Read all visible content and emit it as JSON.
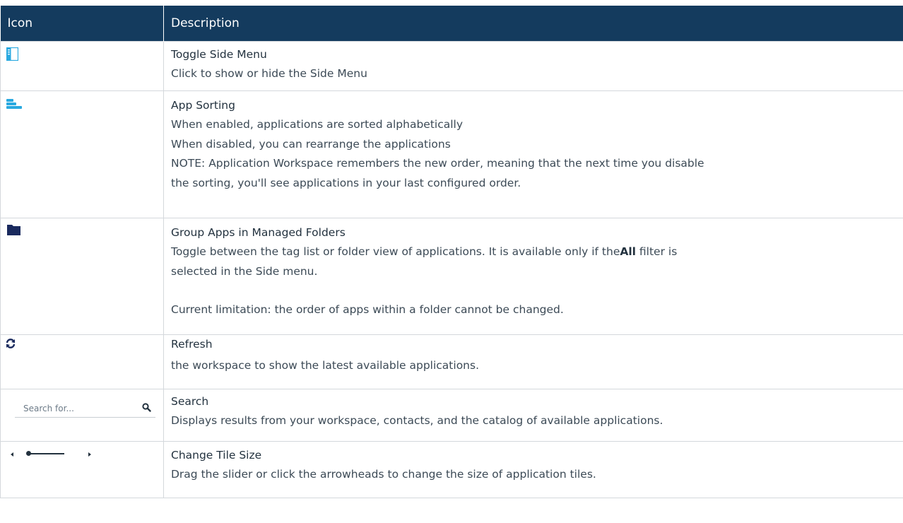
{
  "table": {
    "headers": {
      "icon": "Icon",
      "description": "Description"
    },
    "rows": [
      {
        "title": "Toggle Side Menu",
        "lines": [
          "Click to show or hide the Side Menu"
        ]
      },
      {
        "title": "App Sorting",
        "lines": [
          "When enabled, applications are sorted alphabetically",
          "When disabled, you can rearrange the applications",
          "NOTE: Application Workspace remembers the new order, meaning that the next time you disable",
          "the sorting, you'll see applications in your last configured order."
        ]
      },
      {
        "title": "Group Apps in Managed Folders",
        "line1_pre": "Toggle between the tag list or folder view of applications. It is available only if the",
        "line1_bold": "All",
        "line1_post": " filter is",
        "line2": "selected in the Side menu.",
        "line3": "Current limitation: the order of apps within a folder cannot be changed."
      },
      {
        "title": "Refresh",
        "lines": [
          "the workspace to show the latest available applications."
        ]
      },
      {
        "title": "Search",
        "lines": [
          "Displays results from your workspace, contacts, and the catalog of available applications."
        ],
        "placeholder": "Search for..."
      },
      {
        "title": "Change Tile Size",
        "lines": [
          "Drag the slider or click the arrowheads to change the size of application tiles."
        ]
      }
    ]
  },
  "icons": {
    "row0": "side-menu-icon",
    "row1": "sort-icon",
    "row2": "folder-icon",
    "row3": "refresh-icon",
    "row4": "search-icon",
    "row5": "tile-size-slider"
  },
  "colors": {
    "header_bg": "#143b5e",
    "accent_blue": "#29a9e0",
    "folder_navy": "#1a2a5e"
  }
}
